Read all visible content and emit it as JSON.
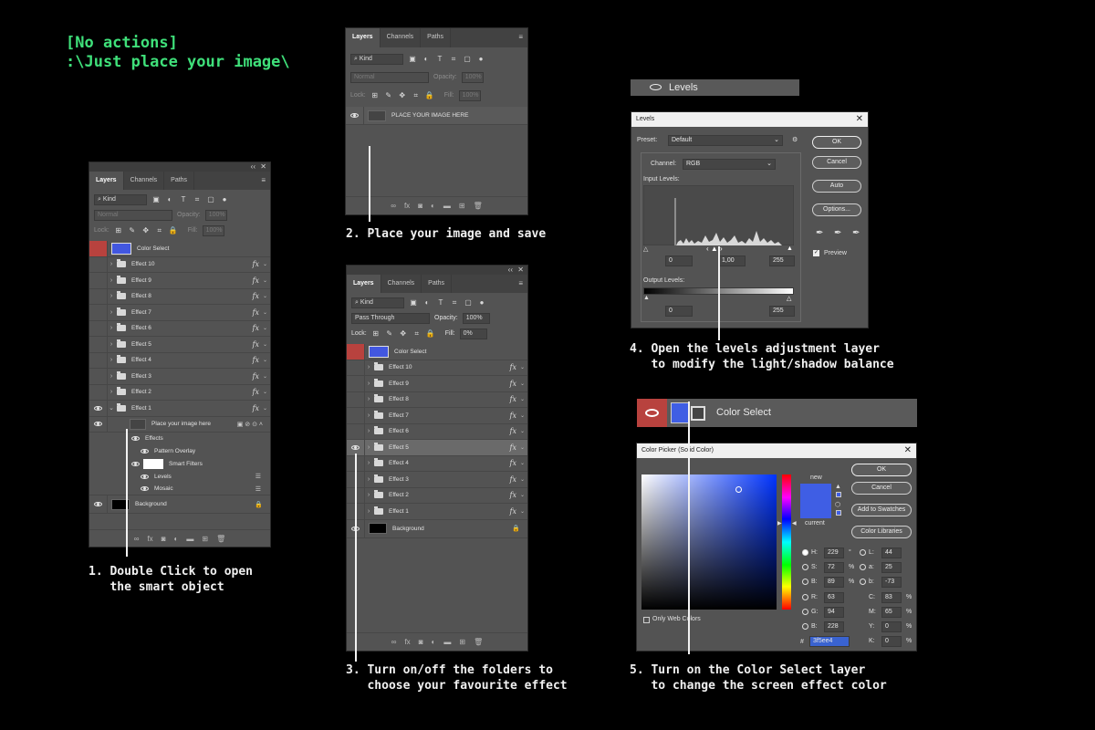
{
  "header": {
    "line1": "[No actions]",
    "line2": ":\\Just place your image\\"
  },
  "captions": {
    "step1": "1. Double Click to open\n   the smart object",
    "step2": "2. Place your image and save",
    "step3": "3. Turn on/off the folders to\n   choose your favourite effect",
    "step4": "4. Open the levels adjustment layer\n   to modify the light/shadow balance",
    "step5": "5. Turn on the Color Select layer\n   to change the screen effect color"
  },
  "layers_panel": {
    "tabs": [
      "Layers",
      "Channels",
      "Paths"
    ],
    "kind_label": "Kind",
    "blend_normal": "Normal",
    "blend_pass": "Pass Through",
    "opacity_label": "Opacity:",
    "opacity_value": "100%",
    "lock_label": "Lock:",
    "fill_label": "Fill:",
    "fill_value_100": "100%",
    "fill_value_0": "0%"
  },
  "panel1": {
    "color_select": "Color Select",
    "effects": [
      "Effect 10",
      "Effect 9",
      "Effect 8",
      "Effect 7",
      "Effect 6",
      "Effect 5",
      "Effect 4",
      "Effect 3",
      "Effect 2",
      "Effect 1"
    ],
    "smart_object": "Place your image here",
    "effects_label": "Effects",
    "pattern_overlay": "Pattern Overlay",
    "smart_filters": "Smart Filters",
    "levels": "Levels",
    "mosaic": "Mosaic",
    "background": "Background"
  },
  "panel2": {
    "layer_name": "PLACE YOUR IMAGE HERE"
  },
  "panel3": {
    "color_select": "Color Select",
    "effects": [
      "Effect 10",
      "Effect 9",
      "Effect 8",
      "Effect 7",
      "Effect 6",
      "Effect 5",
      "Effect 4",
      "Effect 3",
      "Effect 2",
      "Effect 1"
    ],
    "background": "Background"
  },
  "levels_strip": {
    "label": "Levels"
  },
  "levels_dialog": {
    "title": "Levels",
    "preset_label": "Preset:",
    "preset_value": "Default",
    "channel_label": "Channel:",
    "channel_value": "RGB",
    "input_levels": "Input Levels:",
    "output_levels": "Output Levels:",
    "input_values": [
      "0",
      "1,00",
      "255"
    ],
    "output_values": [
      "0",
      "255"
    ],
    "buttons": [
      "OK",
      "Cancel",
      "Auto",
      "Options..."
    ],
    "preview": "Preview"
  },
  "color_select_strip": {
    "label": "Color Select",
    "swatch_color": "#3f5ee4"
  },
  "color_picker": {
    "title": "Color Picker (Solid Color)",
    "new_label": "new",
    "current_label": "current",
    "buttons": [
      "OK",
      "Cancel",
      "Add to Swatches",
      "Color Libraries"
    ],
    "hsb": [
      {
        "label": "H:",
        "value": "229",
        "unit": "°"
      },
      {
        "label": "S:",
        "value": "72",
        "unit": "%"
      },
      {
        "label": "B:",
        "value": "89",
        "unit": "%"
      }
    ],
    "rgb": [
      {
        "label": "R:",
        "value": "63"
      },
      {
        "label": "G:",
        "value": "94"
      },
      {
        "label": "B:",
        "value": "228"
      }
    ],
    "lab": [
      {
        "label": "L:",
        "value": "44"
      },
      {
        "label": "a:",
        "value": "25"
      },
      {
        "label": "b:",
        "value": "-73"
      }
    ],
    "cmyk": [
      {
        "label": "C:",
        "value": "83",
        "unit": "%"
      },
      {
        "label": "M:",
        "value": "65",
        "unit": "%"
      },
      {
        "label": "Y:",
        "value": "0",
        "unit": "%"
      },
      {
        "label": "K:",
        "value": "0",
        "unit": "%"
      }
    ],
    "hex_label": "#",
    "hex_value": "3f5ee4",
    "only_web": "Only Web Colors"
  }
}
